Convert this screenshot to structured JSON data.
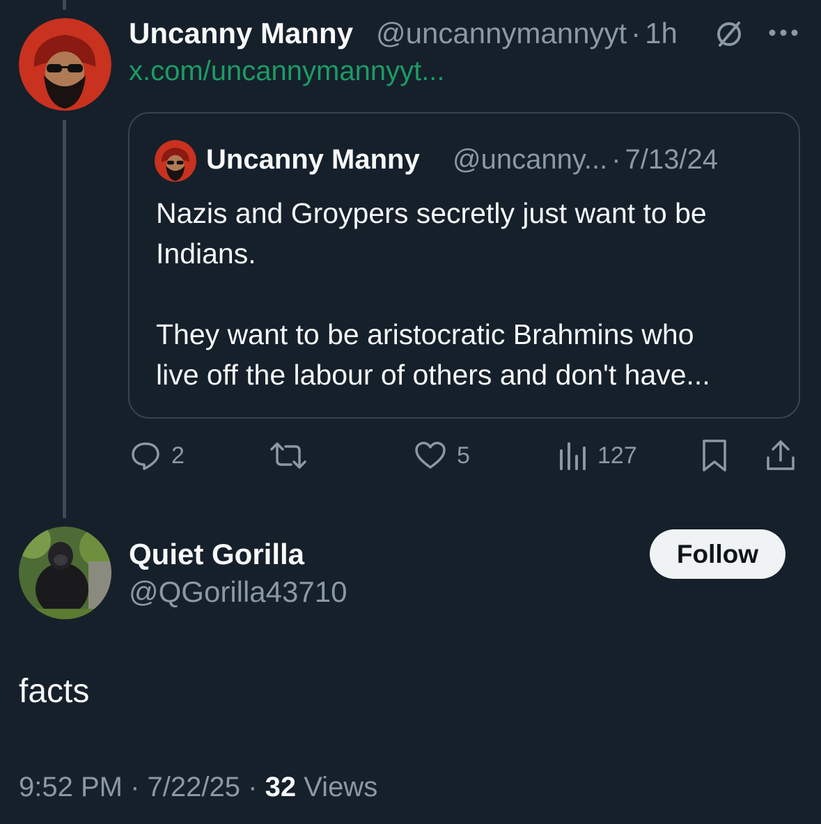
{
  "parent_tweet": {
    "author_name": "Uncanny Manny",
    "handle": "@uncannymannyyt",
    "separator": "·",
    "time": "1h",
    "link_text": "x.com/uncannymannyyt...",
    "more_icon": "more-dots-icon",
    "grok_icon": "grok-slash-icon",
    "quoted": {
      "author_name": "Uncanny Manny",
      "handle": "@uncanny...",
      "separator": "·",
      "date": "7/13/24",
      "line1": "Nazis and Groypers secretly just want to be",
      "line2": "Indians.",
      "line3": "They want to be aristocratic Brahmins who",
      "line4": "live off the labour of others and don't have..."
    },
    "actions": {
      "replies": "2",
      "likes": "5",
      "views": "127"
    }
  },
  "reply_tweet": {
    "author_name": "Quiet Gorilla",
    "handle": "@QGorilla43710",
    "follow_label": "Follow",
    "text": "facts",
    "footer": {
      "time": "9:52 PM",
      "sep1": "·",
      "date": "7/22/25",
      "sep2": "·",
      "views_count": "32",
      "views_label": "Views"
    }
  },
  "colors": {
    "background": "#15202b",
    "link_green": "#1d9b64",
    "muted": "#8b98a5",
    "border": "#38444d"
  }
}
